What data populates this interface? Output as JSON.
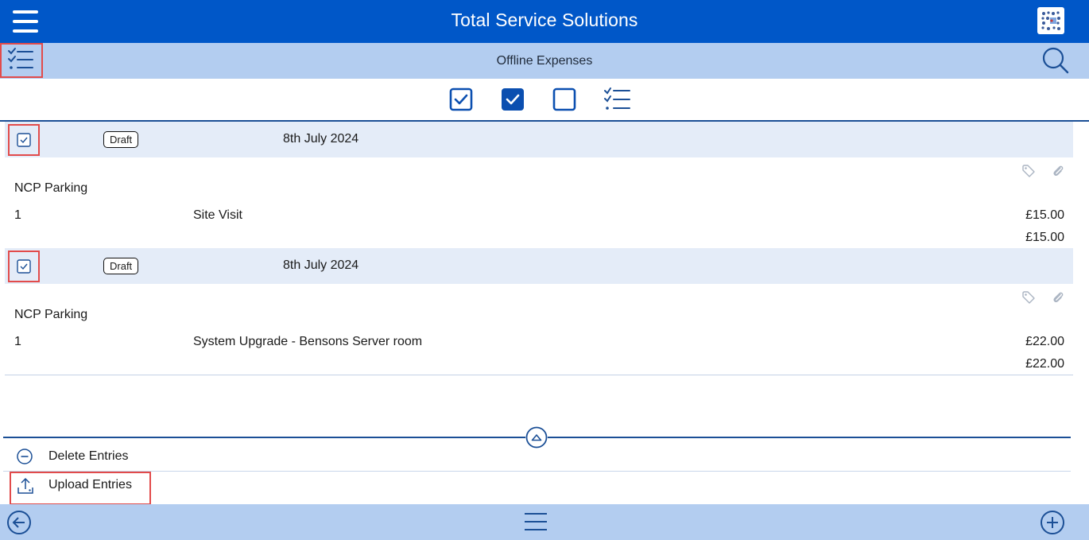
{
  "header": {
    "title": "Total Service Solutions",
    "menu_icon": "hamburger-menu-icon",
    "logo_icon": "app-logo-icon"
  },
  "subheader": {
    "title": "Offline Expenses",
    "list_icon": "checklist-icon",
    "search_icon": "search-icon"
  },
  "filters": [
    {
      "icon": "checkbox-checked-outline-icon"
    },
    {
      "icon": "checkbox-checked-filled-icon"
    },
    {
      "icon": "checkbox-empty-icon"
    },
    {
      "icon": "checklist-icon"
    }
  ],
  "entries": [
    {
      "checked": true,
      "status": "Draft",
      "date": "8th July 2024",
      "category": "NCP Parking",
      "quantity": "1",
      "description": "Site Visit",
      "amount": "£15.00",
      "total": "£15.00"
    },
    {
      "checked": true,
      "status": "Draft",
      "date": "8th July 2024",
      "category": "NCP Parking",
      "quantity": "1",
      "description": "System Upgrade - Bensons Server room",
      "amount": "£22.00",
      "total": "£22.00"
    }
  ],
  "actions": {
    "delete_label": "Delete Entries",
    "upload_label": "Upload Entries"
  },
  "colors": {
    "primary": "#0057c8",
    "bar_light": "#b3cdf0",
    "row_header": "#e4ecf8",
    "highlight": "#e24b4b",
    "icon_blue": "#1b4f96"
  }
}
